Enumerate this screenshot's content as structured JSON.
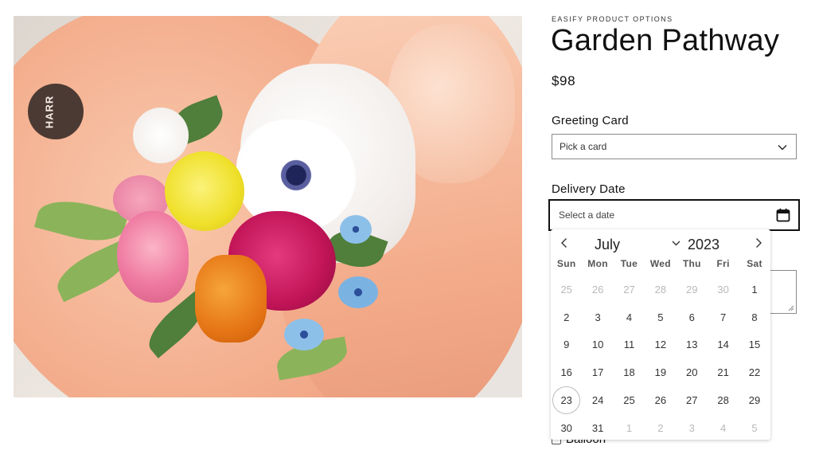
{
  "brand": "EASIFY PRODUCT OPTIONS",
  "product": {
    "title": "Garden Pathway",
    "price": "$98",
    "image_badge_text": "HARR"
  },
  "greeting_card": {
    "label": "Greeting Card",
    "placeholder": "Pick a card",
    "icon": "chevron-down-icon"
  },
  "delivery_date": {
    "label": "Delivery Date",
    "placeholder": "Select a date",
    "icon": "calendar-icon"
  },
  "calendar": {
    "month": "July",
    "year": "2023",
    "weekdays": [
      "Sun",
      "Mon",
      "Tue",
      "Wed",
      "Thu",
      "Fri",
      "Sat"
    ],
    "today": "23",
    "days": [
      {
        "d": "25",
        "muted": true
      },
      {
        "d": "26",
        "muted": true
      },
      {
        "d": "27",
        "muted": true
      },
      {
        "d": "28",
        "muted": true
      },
      {
        "d": "29",
        "muted": true
      },
      {
        "d": "30",
        "muted": true
      },
      {
        "d": "1",
        "muted": false
      },
      {
        "d": "2",
        "muted": false
      },
      {
        "d": "3",
        "muted": false
      },
      {
        "d": "4",
        "muted": false
      },
      {
        "d": "5",
        "muted": false
      },
      {
        "d": "6",
        "muted": false
      },
      {
        "d": "7",
        "muted": false
      },
      {
        "d": "8",
        "muted": false
      },
      {
        "d": "9",
        "muted": false
      },
      {
        "d": "10",
        "muted": false
      },
      {
        "d": "11",
        "muted": false
      },
      {
        "d": "12",
        "muted": false
      },
      {
        "d": "13",
        "muted": false
      },
      {
        "d": "14",
        "muted": false
      },
      {
        "d": "15",
        "muted": false
      },
      {
        "d": "16",
        "muted": false
      },
      {
        "d": "17",
        "muted": false
      },
      {
        "d": "18",
        "muted": false
      },
      {
        "d": "19",
        "muted": false
      },
      {
        "d": "20",
        "muted": false
      },
      {
        "d": "21",
        "muted": false
      },
      {
        "d": "22",
        "muted": false
      },
      {
        "d": "23",
        "muted": false
      },
      {
        "d": "24",
        "muted": false
      },
      {
        "d": "25",
        "muted": false
      },
      {
        "d": "26",
        "muted": false
      },
      {
        "d": "27",
        "muted": false
      },
      {
        "d": "28",
        "muted": false
      },
      {
        "d": "29",
        "muted": false
      },
      {
        "d": "30",
        "muted": false
      },
      {
        "d": "31",
        "muted": false
      },
      {
        "d": "1",
        "muted": true
      },
      {
        "d": "2",
        "muted": true
      },
      {
        "d": "3",
        "muted": true
      },
      {
        "d": "4",
        "muted": true
      },
      {
        "d": "5",
        "muted": true
      }
    ]
  },
  "balloon": {
    "label": "Balloon"
  },
  "colors": {
    "text": "#111111",
    "muted_day": "#b9b9b9",
    "border": "#8a8a8a"
  }
}
